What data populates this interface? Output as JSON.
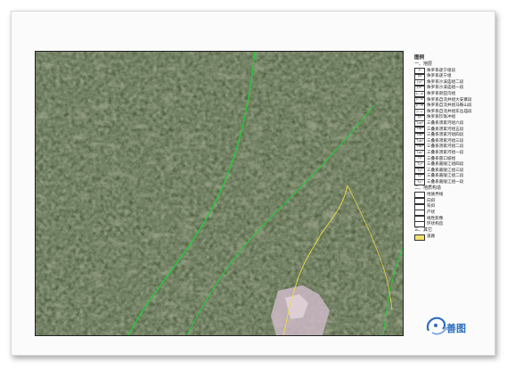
{
  "legend": {
    "title": "图例",
    "sections": [
      {
        "heading": "一、地层",
        "items": [
          {
            "code": "Jₚ",
            "label": "侏罗系遂宁组段",
            "color": "#ffffff"
          },
          {
            "code": "J₂s",
            "label": "侏罗系遂宁组",
            "color": "#ffffff"
          },
          {
            "code": "J₂s²",
            "label": "侏罗系沙溪庙组二段",
            "color": "#ffffff"
          },
          {
            "code": "J₂s¹",
            "label": "侏罗系沙溪庙组一段",
            "color": "#ffffff"
          },
          {
            "code": "J₁₋₂x",
            "label": "侏罗系新田沟组",
            "color": "#ffffff"
          },
          {
            "code": "J₁₋₂z",
            "label": "侏罗系自流井组大安寨段",
            "color": "#ffffff"
          },
          {
            "code": "J₁₋₂d",
            "label": "侏罗系自流井组马鞍山段",
            "color": "#ffffff"
          },
          {
            "code": "J₁₋₂ₚ",
            "label": "侏罗系自流井组东岳庙段",
            "color": "#ffffff"
          },
          {
            "code": "J₁z",
            "label": "侏罗系珍珠冲组",
            "color": "#ffffff"
          },
          {
            "code": "T₃xj⁶",
            "label": "三叠系须家河组六段",
            "color": "#ffffff"
          },
          {
            "code": "T₃xj⁵",
            "label": "三叠系须家河组五段",
            "color": "#ffffff"
          },
          {
            "code": "T₃xj⁴",
            "label": "三叠系须家河组四段",
            "color": "#ffffff"
          },
          {
            "code": "T₃xj³",
            "label": "三叠系须家河组三段",
            "color": "#ffffff"
          },
          {
            "code": "T₃xj²",
            "label": "三叠系须家河组二段",
            "color": "#ffffff"
          },
          {
            "code": "T₃xj¹",
            "label": "三叠系须家河组一段",
            "color": "#ffffff"
          },
          {
            "code": "T₂l",
            "label": "三叠系雷口坡组",
            "color": "#ffffff"
          },
          {
            "code": "T₁j⁴",
            "label": "三叠系嘉陵江组四段",
            "color": "#ffffff"
          },
          {
            "code": "T₁j³",
            "label": "三叠系嘉陵江组三段",
            "color": "#ffffff"
          },
          {
            "code": "T₁j²",
            "label": "三叠系嘉陵江组二段",
            "color": "#ffffff"
          },
          {
            "code": "T₁j¹",
            "label": "三叠系嘉陵江组一段",
            "color": "#ffffff"
          }
        ]
      },
      {
        "heading": "二、地质构造",
        "items": [
          {
            "code": "",
            "label": "地质界线",
            "color": "#ffffff"
          },
          {
            "code": "",
            "label": "向斜",
            "color": "#ffffff"
          },
          {
            "code": "",
            "label": "背斜",
            "color": "#ffffff"
          },
          {
            "code": "",
            "label": "产状",
            "color": "#ffffff"
          },
          {
            "code": "",
            "label": "线性影像",
            "color": "#ffffff"
          },
          {
            "code": "",
            "label": "环状构造",
            "color": "#ffffff"
          }
        ]
      },
      {
        "heading": "三、其它",
        "items": [
          {
            "code": "",
            "label": "道路",
            "color": "#f2e36b"
          }
        ]
      }
    ]
  },
  "logo": {
    "text": "善图"
  },
  "colors": {
    "terrain_dark": "#3f4d31",
    "terrain_mid": "#5e6e48",
    "terrain_light": "#8a8f6c",
    "lineament": "#25c93a",
    "road": "#f0dc3c",
    "urban": "#d8c9d2"
  }
}
